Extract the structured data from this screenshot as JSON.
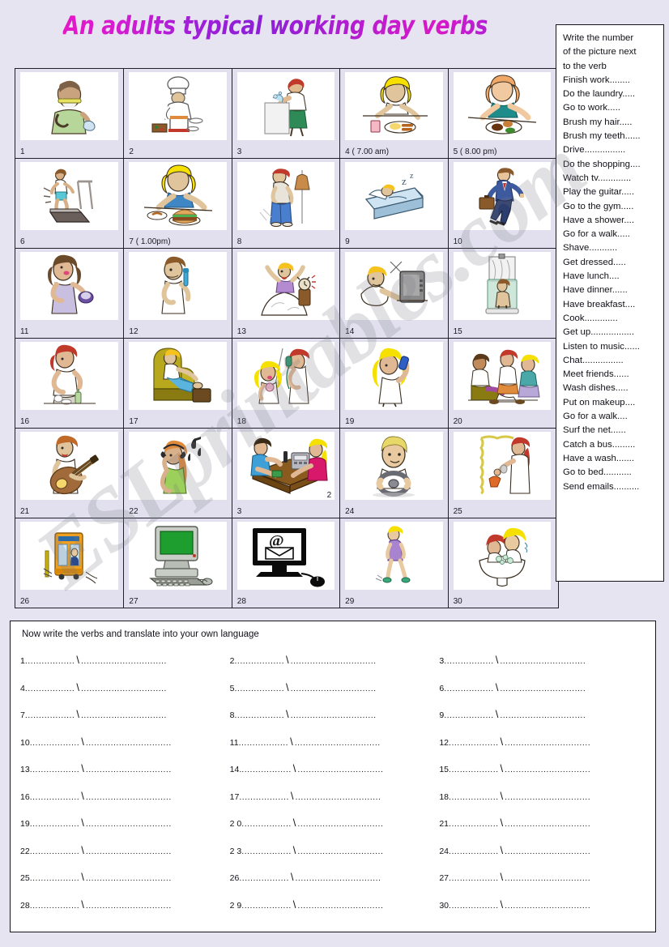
{
  "title": "An adults typical working day verbs",
  "watermark": "ESLprintables.com",
  "verb_panel": {
    "intro": [
      "Write the number",
      "of the picture next",
      "to the verb"
    ],
    "items": [
      "Finish work........",
      "Do the laundry.....",
      "Go to work.....",
      "Brush my hair.....",
      "Brush my teeth......",
      "Drive................",
      "Do the shopping....",
      "Watch tv.............",
      "Play the guitar.....",
      "Go to the gym.....",
      "Have a shower....",
      "Go for a walk.....",
      "Shave...........",
      "Get dressed.....",
      "Have lunch....",
      "Have dinner......",
      "Have breakfast....",
      "Cook.............",
      "Get up.................",
      "Listen to music......",
      "Chat................",
      "Meet friends......",
      "Wash dishes.....",
      "Put on makeup....",
      "Go for a walk....",
      "Surf the net......",
      "Catch a bus.........",
      "Have a wash.......",
      "Go to bed...........",
      "Send emails.........."
    ]
  },
  "grid": {
    "rows": [
      [
        {
          "label": "1",
          "icon": "man-shaving-icon"
        },
        {
          "label": "2",
          "icon": "chef-cooking-icon"
        },
        {
          "label": "3",
          "icon": "woman-washing-dishes-icon"
        },
        {
          "label": "4  ( 7.00 am)",
          "icon": "breakfast-icon"
        },
        {
          "label": "5  ( 8.00 pm)",
          "icon": "dinner-icon"
        }
      ],
      [
        {
          "label": "6",
          "icon": "treadmill-gym-icon"
        },
        {
          "label": "7  ( 1.00pm)",
          "icon": "lunch-burger-icon"
        },
        {
          "label": "8",
          "icon": "get-dressed-icon"
        },
        {
          "label": "9",
          "icon": "bed-sleeping-icon"
        },
        {
          "label": "10",
          "icon": "businessman-going-to-work-icon"
        }
      ],
      [
        {
          "label": "11",
          "icon": "put-on-makeup-icon"
        },
        {
          "label": "12",
          "icon": "brush-teeth-icon"
        },
        {
          "label": "13",
          "icon": "get-up-alarm-icon"
        },
        {
          "label": "14",
          "icon": "watch-tv-icon"
        },
        {
          "label": "15",
          "icon": "have-shower-icon"
        }
      ],
      [
        {
          "label": "16",
          "icon": "wash-dishes-icon"
        },
        {
          "label": "17",
          "icon": "relax-armchair-icon"
        },
        {
          "label": "18",
          "icon": "chat-phone-icon"
        },
        {
          "label": "19",
          "icon": "brush-hair-icon"
        },
        {
          "label": "20",
          "icon": "meet-friends-icon"
        }
      ],
      [
        {
          "label": "21",
          "icon": "play-guitar-icon"
        },
        {
          "label": "22",
          "icon": "listen-music-icon"
        },
        {
          "label": "3",
          "label_inset": "2",
          "icon": "do-shopping-icon"
        },
        {
          "label": "24",
          "icon": "drive-icon"
        },
        {
          "label": "25",
          "icon": "finish-work-icon"
        }
      ],
      [
        {
          "label": "26",
          "icon": "catch-bus-icon"
        },
        {
          "label": "27",
          "icon": "computer-icon"
        },
        {
          "label": "28",
          "icon": "send-emails-icon"
        },
        {
          "label": "29",
          "icon": "go-for-walk-icon"
        },
        {
          "label": "30",
          "icon": "have-wash-icon"
        }
      ]
    ]
  },
  "write_section": {
    "instruction": "Now write the verbs and translate into your own language",
    "dots_a": "..................",
    "dots_b": "...............................",
    "slash": "\\",
    "rows": [
      [
        "1",
        "2",
        "3"
      ],
      [
        "4",
        "5",
        "6"
      ],
      [
        "7",
        "8",
        "9"
      ],
      [
        "10",
        "11",
        "12"
      ],
      [
        "13",
        "14.",
        "15"
      ],
      [
        "16",
        "17",
        "18"
      ],
      [
        "19",
        "2 0",
        "21"
      ],
      [
        "22",
        "2 3",
        "24"
      ],
      [
        "25",
        "26",
        "27"
      ],
      [
        "28",
        "2 9",
        "30"
      ]
    ]
  }
}
